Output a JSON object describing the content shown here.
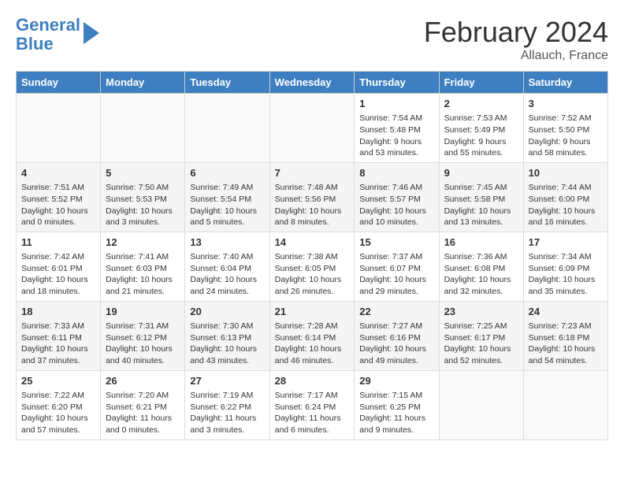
{
  "header": {
    "logo_line1": "General",
    "logo_line2": "Blue",
    "month": "February 2024",
    "location": "Allauch, France"
  },
  "weekdays": [
    "Sunday",
    "Monday",
    "Tuesday",
    "Wednesday",
    "Thursday",
    "Friday",
    "Saturday"
  ],
  "weeks": [
    [
      {
        "day": "",
        "info": ""
      },
      {
        "day": "",
        "info": ""
      },
      {
        "day": "",
        "info": ""
      },
      {
        "day": "",
        "info": ""
      },
      {
        "day": "1",
        "info": "Sunrise: 7:54 AM\nSunset: 5:48 PM\nDaylight: 9 hours\nand 53 minutes."
      },
      {
        "day": "2",
        "info": "Sunrise: 7:53 AM\nSunset: 5:49 PM\nDaylight: 9 hours\nand 55 minutes."
      },
      {
        "day": "3",
        "info": "Sunrise: 7:52 AM\nSunset: 5:50 PM\nDaylight: 9 hours\nand 58 minutes."
      }
    ],
    [
      {
        "day": "4",
        "info": "Sunrise: 7:51 AM\nSunset: 5:52 PM\nDaylight: 10 hours\nand 0 minutes."
      },
      {
        "day": "5",
        "info": "Sunrise: 7:50 AM\nSunset: 5:53 PM\nDaylight: 10 hours\nand 3 minutes."
      },
      {
        "day": "6",
        "info": "Sunrise: 7:49 AM\nSunset: 5:54 PM\nDaylight: 10 hours\nand 5 minutes."
      },
      {
        "day": "7",
        "info": "Sunrise: 7:48 AM\nSunset: 5:56 PM\nDaylight: 10 hours\nand 8 minutes."
      },
      {
        "day": "8",
        "info": "Sunrise: 7:46 AM\nSunset: 5:57 PM\nDaylight: 10 hours\nand 10 minutes."
      },
      {
        "day": "9",
        "info": "Sunrise: 7:45 AM\nSunset: 5:58 PM\nDaylight: 10 hours\nand 13 minutes."
      },
      {
        "day": "10",
        "info": "Sunrise: 7:44 AM\nSunset: 6:00 PM\nDaylight: 10 hours\nand 16 minutes."
      }
    ],
    [
      {
        "day": "11",
        "info": "Sunrise: 7:42 AM\nSunset: 6:01 PM\nDaylight: 10 hours\nand 18 minutes."
      },
      {
        "day": "12",
        "info": "Sunrise: 7:41 AM\nSunset: 6:03 PM\nDaylight: 10 hours\nand 21 minutes."
      },
      {
        "day": "13",
        "info": "Sunrise: 7:40 AM\nSunset: 6:04 PM\nDaylight: 10 hours\nand 24 minutes."
      },
      {
        "day": "14",
        "info": "Sunrise: 7:38 AM\nSunset: 6:05 PM\nDaylight: 10 hours\nand 26 minutes."
      },
      {
        "day": "15",
        "info": "Sunrise: 7:37 AM\nSunset: 6:07 PM\nDaylight: 10 hours\nand 29 minutes."
      },
      {
        "day": "16",
        "info": "Sunrise: 7:36 AM\nSunset: 6:08 PM\nDaylight: 10 hours\nand 32 minutes."
      },
      {
        "day": "17",
        "info": "Sunrise: 7:34 AM\nSunset: 6:09 PM\nDaylight: 10 hours\nand 35 minutes."
      }
    ],
    [
      {
        "day": "18",
        "info": "Sunrise: 7:33 AM\nSunset: 6:11 PM\nDaylight: 10 hours\nand 37 minutes."
      },
      {
        "day": "19",
        "info": "Sunrise: 7:31 AM\nSunset: 6:12 PM\nDaylight: 10 hours\nand 40 minutes."
      },
      {
        "day": "20",
        "info": "Sunrise: 7:30 AM\nSunset: 6:13 PM\nDaylight: 10 hours\nand 43 minutes."
      },
      {
        "day": "21",
        "info": "Sunrise: 7:28 AM\nSunset: 6:14 PM\nDaylight: 10 hours\nand 46 minutes."
      },
      {
        "day": "22",
        "info": "Sunrise: 7:27 AM\nSunset: 6:16 PM\nDaylight: 10 hours\nand 49 minutes."
      },
      {
        "day": "23",
        "info": "Sunrise: 7:25 AM\nSunset: 6:17 PM\nDaylight: 10 hours\nand 52 minutes."
      },
      {
        "day": "24",
        "info": "Sunrise: 7:23 AM\nSunset: 6:18 PM\nDaylight: 10 hours\nand 54 minutes."
      }
    ],
    [
      {
        "day": "25",
        "info": "Sunrise: 7:22 AM\nSunset: 6:20 PM\nDaylight: 10 hours\nand 57 minutes."
      },
      {
        "day": "26",
        "info": "Sunrise: 7:20 AM\nSunset: 6:21 PM\nDaylight: 11 hours\nand 0 minutes."
      },
      {
        "day": "27",
        "info": "Sunrise: 7:19 AM\nSunset: 6:22 PM\nDaylight: 11 hours\nand 3 minutes."
      },
      {
        "day": "28",
        "info": "Sunrise: 7:17 AM\nSunset: 6:24 PM\nDaylight: 11 hours\nand 6 minutes."
      },
      {
        "day": "29",
        "info": "Sunrise: 7:15 AM\nSunset: 6:25 PM\nDaylight: 11 hours\nand 9 minutes."
      },
      {
        "day": "",
        "info": ""
      },
      {
        "day": "",
        "info": ""
      }
    ]
  ]
}
